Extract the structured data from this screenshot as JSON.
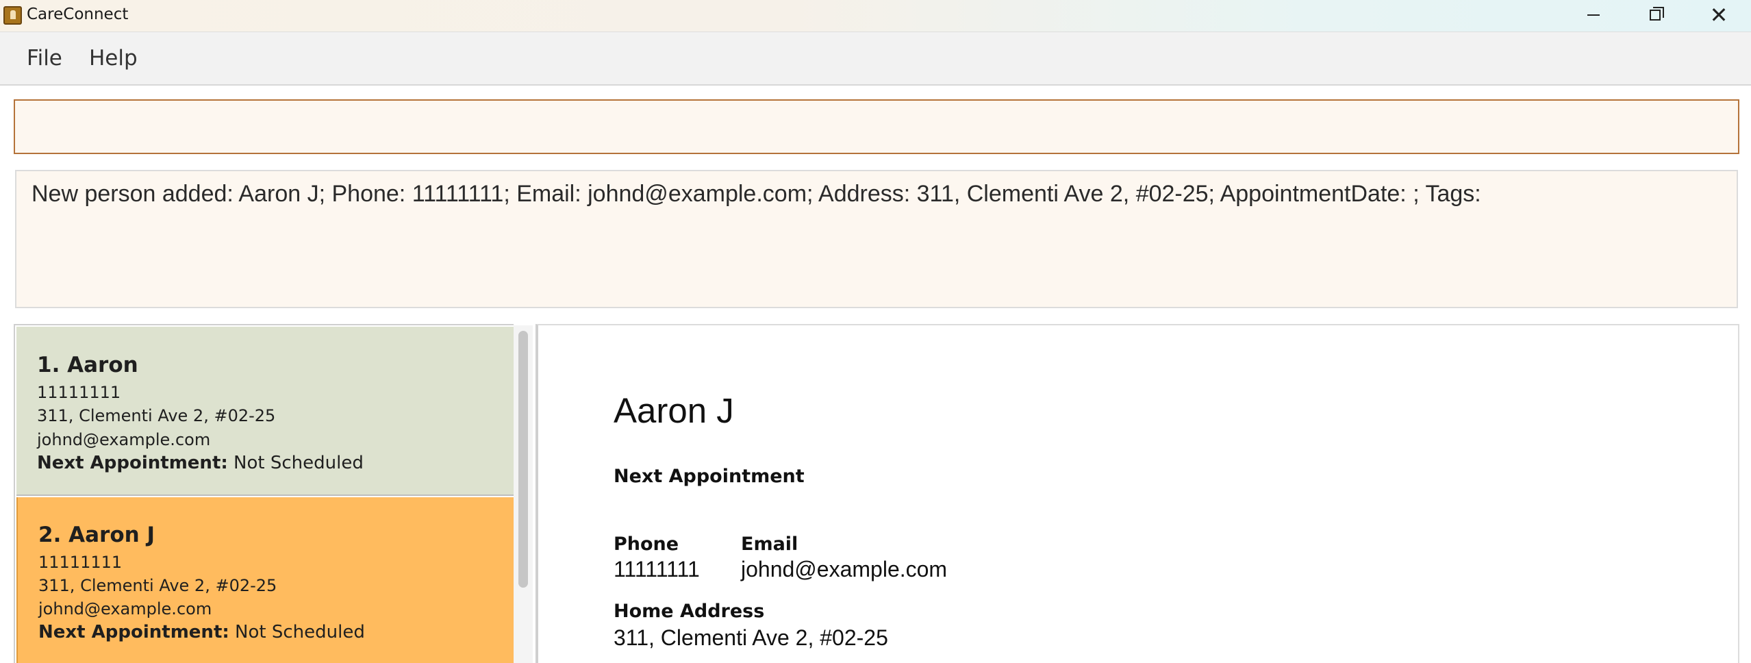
{
  "window": {
    "title": "CareConnect",
    "icon": "app-icon"
  },
  "menu": {
    "items": [
      {
        "label": "File"
      },
      {
        "label": "Help"
      }
    ]
  },
  "command_box": {
    "value": ""
  },
  "result": {
    "message": "New person added: Aaron J; Phone: 11111111; Email: johnd@example.com; Address: 311, Clementi Ave 2, #02-25; AppointmentDate: ; Tags:"
  },
  "person_list": {
    "selected_index": 1,
    "items": [
      {
        "name": "1. Aaron",
        "phone": "11111111",
        "address": "311, Clementi Ave 2, #02-25",
        "email": "johnd@example.com",
        "appointment_label": "Next Appointment:",
        "appointment_value": "Not Scheduled"
      },
      {
        "name": "2. Aaron J",
        "phone": "11111111",
        "address": "311, Clementi Ave 2, #02-25",
        "email": "johnd@example.com",
        "appointment_label": "Next Appointment:",
        "appointment_value": "Not Scheduled"
      }
    ]
  },
  "detail": {
    "name": "Aaron J",
    "appointment_label": "Next Appointment",
    "phone_label": "Phone",
    "phone": "11111111",
    "email_label": "Email",
    "email": "johnd@example.com",
    "address_label": "Home Address",
    "address": "311, Clementi Ave 2, #02-25"
  },
  "colors": {
    "card_default": "#dde2cf",
    "card_selected": "#ffbb5e",
    "command_border": "#b5733a",
    "panel_background": "#fdf7f0"
  }
}
